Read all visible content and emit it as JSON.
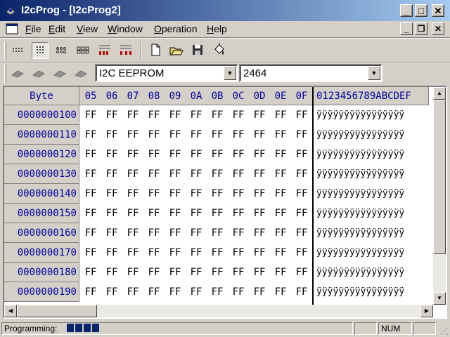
{
  "window": {
    "title": "I2cProg - [I2cProg2]",
    "minimize_glyph": "_",
    "maximize_glyph": "□",
    "close_glyph": "✕"
  },
  "menu": {
    "items": [
      {
        "accel": "F",
        "rest": "ile"
      },
      {
        "accel": "E",
        "rest": "dit"
      },
      {
        "accel": "V",
        "rest": "iew"
      },
      {
        "accel": "W",
        "rest": "indow"
      },
      {
        "accel": "O",
        "rest": "peration"
      },
      {
        "accel": "H",
        "rest": "elp"
      }
    ],
    "mdi_minimize": "_",
    "mdi_restore": "❐",
    "mdi_close": "✕"
  },
  "toolbar": {
    "buttons": [
      "view-ascii-icon",
      "view-byte-icon",
      "view-word-icon",
      "view-dword-icon",
      "view-binary-icon",
      "view-binary-alt-icon",
      "new-file-icon",
      "open-file-icon",
      "save-icon",
      "paint-bucket-icon"
    ]
  },
  "device_bar": {
    "chip_buttons": [
      "read-chip-icon",
      "write-chip-icon",
      "verify-chip-icon",
      "erase-chip-icon"
    ],
    "device_type": "I2C EEPROM",
    "device_model": "2464"
  },
  "grid": {
    "corner_header": "Byte",
    "columns": [
      "05",
      "06",
      "07",
      "08",
      "09",
      "0A",
      "0B",
      "0C",
      "0D",
      "0E",
      "0F"
    ],
    "ascii_header": "0123456789ABCDEF",
    "rows": [
      {
        "addr": "0000000100",
        "cells": [
          "FF",
          "FF",
          "FF",
          "FF",
          "FF",
          "FF",
          "FF",
          "FF",
          "FF",
          "FF",
          "FF"
        ],
        "ascii": "ÿÿÿÿÿÿÿÿÿÿÿÿÿÿÿÿ"
      },
      {
        "addr": "0000000110",
        "cells": [
          "FF",
          "FF",
          "FF",
          "FF",
          "FF",
          "FF",
          "FF",
          "FF",
          "FF",
          "FF",
          "FF"
        ],
        "ascii": "ÿÿÿÿÿÿÿÿÿÿÿÿÿÿÿÿ"
      },
      {
        "addr": "0000000120",
        "cells": [
          "FF",
          "FF",
          "FF",
          "FF",
          "FF",
          "FF",
          "FF",
          "FF",
          "FF",
          "FF",
          "FF"
        ],
        "ascii": "ÿÿÿÿÿÿÿÿÿÿÿÿÿÿÿÿ"
      },
      {
        "addr": "0000000130",
        "cells": [
          "FF",
          "FF",
          "FF",
          "FF",
          "FF",
          "FF",
          "FF",
          "FF",
          "FF",
          "FF",
          "FF"
        ],
        "ascii": "ÿÿÿÿÿÿÿÿÿÿÿÿÿÿÿÿ"
      },
      {
        "addr": "0000000140",
        "cells": [
          "FF",
          "FF",
          "FF",
          "FF",
          "FF",
          "FF",
          "FF",
          "FF",
          "FF",
          "FF",
          "FF"
        ],
        "ascii": "ÿÿÿÿÿÿÿÿÿÿÿÿÿÿÿÿ"
      },
      {
        "addr": "0000000150",
        "cells": [
          "FF",
          "FF",
          "FF",
          "FF",
          "FF",
          "FF",
          "FF",
          "FF",
          "FF",
          "FF",
          "FF"
        ],
        "ascii": "ÿÿÿÿÿÿÿÿÿÿÿÿÿÿÿÿ"
      },
      {
        "addr": "0000000160",
        "cells": [
          "FF",
          "FF",
          "FF",
          "FF",
          "FF",
          "FF",
          "FF",
          "FF",
          "FF",
          "FF",
          "FF"
        ],
        "ascii": "ÿÿÿÿÿÿÿÿÿÿÿÿÿÿÿÿ"
      },
      {
        "addr": "0000000170",
        "cells": [
          "FF",
          "FF",
          "FF",
          "FF",
          "FF",
          "FF",
          "FF",
          "FF",
          "FF",
          "FF",
          "FF"
        ],
        "ascii": "ÿÿÿÿÿÿÿÿÿÿÿÿÿÿÿÿ"
      },
      {
        "addr": "0000000180",
        "cells": [
          "FF",
          "FF",
          "FF",
          "FF",
          "FF",
          "FF",
          "FF",
          "FF",
          "FF",
          "FF",
          "FF"
        ],
        "ascii": "ÿÿÿÿÿÿÿÿÿÿÿÿÿÿÿÿ"
      },
      {
        "addr": "0000000190",
        "cells": [
          "FF",
          "FF",
          "FF",
          "FF",
          "FF",
          "FF",
          "FF",
          "FF",
          "FF",
          "FF",
          "FF"
        ],
        "ascii": "ÿÿÿÿÿÿÿÿÿÿÿÿÿÿÿÿ"
      }
    ]
  },
  "status": {
    "programming_label": "Programming:",
    "progress_blocks": 4,
    "num_indicator": "NUM"
  },
  "colors": {
    "title_active": "#0a246a",
    "title_gradient_end": "#a6caf0",
    "header_text": "#0000a0",
    "face": "#d4d0c8",
    "progress": "#0a246a"
  }
}
